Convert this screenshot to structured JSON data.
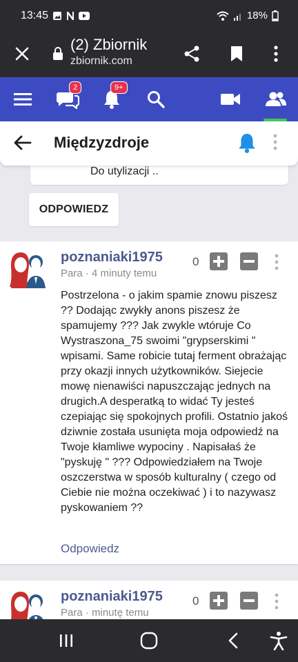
{
  "status": {
    "time": "13:45",
    "battery": "18%"
  },
  "browser": {
    "title": "(2) Zbiornik",
    "url": "zbiornik.com"
  },
  "nav": {
    "messages_badge": "2",
    "notifications_badge": "9+"
  },
  "topic": {
    "title": "Międzyzdroje"
  },
  "previous_snippet": "Do utylizacji ..",
  "reply_button": "ODPOWIEDZ",
  "posts": [
    {
      "author": "poznaniaki1975",
      "meta": "Para · 4 minuty temu",
      "score": "0",
      "body": "Postrzelona - o jakim spamie znowu piszesz ?? Dodając zwykły anons piszesz że spamujemy ??? Jak zwykle wtóruje Co Wystraszona_75 swoimi \"grypserskimi \" wpisami. Same robicie tutaj ferment obrażając przy okazji innych użytkowników. Siejecie mowę nienawiści napuszczając jednych na drugich.A desperatką to widać Ty jesteś czepiając się spokojnych profili. Ostatnio jakoś dziwnie została usunięta moja odpowiedź na Twoje kłamliwe wypociny . Napisałaś że \"pyskuję \" ??? Odpowiedziałem na Twoje oszczerstwa w sposób kulturalny ( czego od Ciebie nie można oczekiwać ) i to nazywasz pyskowaniem ??",
      "reply_link": "Odpowiedz"
    },
    {
      "author": "poznaniaki1975",
      "meta": "Para · minutę temu",
      "score": "0"
    }
  ],
  "colors": {
    "nav_bg": "#3d4bc2",
    "accent_blue": "#4b5a8f",
    "badge_red": "#e8314a",
    "active_green": "#43c759"
  }
}
